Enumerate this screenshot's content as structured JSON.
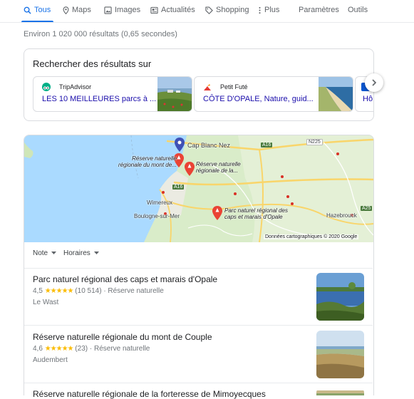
{
  "nav": {
    "tabs": [
      {
        "label": "Tous",
        "icon": "search-icon"
      },
      {
        "label": "Maps",
        "icon": "map-pin-icon"
      },
      {
        "label": "Images",
        "icon": "image-icon"
      },
      {
        "label": "Actualités",
        "icon": "news-icon"
      },
      {
        "label": "Shopping",
        "icon": "tag-icon"
      },
      {
        "label": "Plus",
        "icon": "more-vert-icon"
      }
    ],
    "settings": "Paramètres",
    "tools": "Outils"
  },
  "stats": "Environ 1 020 000 résultats (0,65 secondes)",
  "sources_card": {
    "title": "Rechercher des résultats sur",
    "sources": [
      {
        "name": "TripAdvisor",
        "link": "LES 10 MEILLEURES parcs à ..."
      },
      {
        "name": "Petit Futé",
        "link": "CÔTE D'OPALE, Nature, guid..."
      },
      {
        "name": "",
        "link": "Hô"
      }
    ]
  },
  "map": {
    "labels": {
      "cap_blanc_nez": "Cap Blanc Nez",
      "wimereux": "Wimereux",
      "boulogne": "Boulogne-sur-Mer",
      "hazebrouck": "Hazebrouck",
      "reserve1_l1": "Réserve naturelle",
      "reserve1_l2": "régionale du mont de...",
      "reserve2_l1": "Réserve naturelle",
      "reserve2_l2": "régionale de la...",
      "parc_l1": "Parc naturel régional des",
      "parc_l2": "caps et marais d'Opale",
      "credit": "Données cartographiques © 2020 Google"
    },
    "roads": {
      "a16_top": "A16",
      "a16_mid": "A16",
      "n225": "N225",
      "a25": "A25"
    }
  },
  "filters": {
    "note": "Note",
    "hours": "Horaires"
  },
  "places": [
    {
      "title": "Parc naturel régional des caps et marais d'Opale",
      "rating": "4,5",
      "stars": "★★★★★",
      "reviews": "(10 514)",
      "category": "· Réserve naturelle",
      "address": "Le Wast"
    },
    {
      "title": "Réserve naturelle régionale du mont de Couple",
      "rating": "4,6",
      "stars": "★★★★★",
      "reviews": "(23)",
      "category": "· Réserve naturelle",
      "address": "Audembert"
    },
    {
      "title": "Réserve naturelle régionale de la forteresse de Mimoyecques",
      "rating": "",
      "stars": "",
      "reviews": "",
      "category": "",
      "address": ""
    }
  ],
  "colors": {
    "accent": "#1a73e8",
    "link": "#1a0dab",
    "star": "#fbbc04",
    "pin": "#ea4335"
  }
}
